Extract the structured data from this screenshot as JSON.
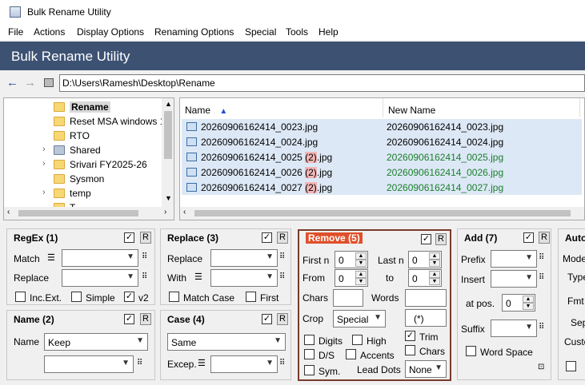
{
  "window": {
    "title": "Bulk Rename Utility"
  },
  "menu": [
    "File",
    "Actions",
    "Display Options",
    "Renaming Options",
    "Special",
    "Tools",
    "Help"
  ],
  "banner": "Bulk Rename Utility",
  "path": "D:\\Users\\Ramesh\\Desktop\\Rename",
  "tree": [
    {
      "label": "Rename",
      "selected": true,
      "expandable": false
    },
    {
      "label": "Reset MSA windows 1",
      "expandable": false
    },
    {
      "label": "RTO",
      "expandable": false
    },
    {
      "label": "Shared",
      "expandable": true
    },
    {
      "label": "Srivari FY2025-26",
      "expandable": true
    },
    {
      "label": "Sysmon",
      "expandable": false
    },
    {
      "label": "temp",
      "expandable": true
    },
    {
      "label": "T...",
      "expandable": false
    }
  ],
  "columns": {
    "name": "Name",
    "new_name": "New Name"
  },
  "files": [
    {
      "name_pre": "20260906162414_0023",
      "name_hl": "",
      "name_post": ".jpg",
      "new_name": "20260906162414_0023.jpg",
      "changed": false
    },
    {
      "name_pre": "20260906162414_0024",
      "name_hl": "",
      "name_post": ".jpg",
      "new_name": "20260906162414_0024.jpg",
      "changed": false
    },
    {
      "name_pre": "20260906162414_0025 ",
      "name_hl": "(2)",
      "name_post": ".jpg",
      "new_name": "20260906162414_0025.jpg",
      "changed": true
    },
    {
      "name_pre": "20260906162414_0026 ",
      "name_hl": "(2)",
      "name_post": ".jpg",
      "new_name": "20260906162414_0026.jpg",
      "changed": true
    },
    {
      "name_pre": "20260906162414_0027 ",
      "name_hl": "(2)",
      "name_post": ".jpg",
      "new_name": "20260906162414_0027.jpg",
      "changed": true
    }
  ],
  "regex": {
    "title": "RegEx (1)",
    "match_label": "Match",
    "replace_label": "Replace",
    "incext": "Inc.Ext.",
    "simple": "Simple",
    "v2": "v2"
  },
  "replace": {
    "title": "Replace (3)",
    "replace_label": "Replace",
    "with_label": "With",
    "match_case": "Match Case",
    "first": "First"
  },
  "name": {
    "title": "Name (2)",
    "label": "Name",
    "value": "Keep"
  },
  "case": {
    "title": "Case (4)",
    "value": "Same",
    "excep_label": "Excep."
  },
  "remove": {
    "title": "Remove (5)",
    "first_n": "First n",
    "first_n_val": "0",
    "last_n": "Last n",
    "last_n_val": "0",
    "from": "From",
    "from_val": "0",
    "to": "to",
    "to_val": "0",
    "chars": "Chars",
    "words": "Words",
    "crop": "Crop",
    "crop_val": "Special",
    "crop_text": "(*)",
    "digits": "Digits",
    "high": "High",
    "trim": "Trim",
    "ds": "D/S",
    "accents": "Accents",
    "chars2": "Chars",
    "sym": "Sym.",
    "lead_dots": "Lead Dots",
    "lead_val": "None"
  },
  "add": {
    "title": "Add (7)",
    "prefix": "Prefix",
    "insert": "Insert",
    "at_pos": "at pos.",
    "pos_val": "0",
    "suffix": "Suffix",
    "word_space": "Word Space"
  },
  "auto": {
    "title": "Auto",
    "mode": "Mode",
    "type": "Type",
    "fmt": "Fmt",
    "sep": "Sep",
    "custom": "Custo"
  },
  "r_label": "R",
  "colors": {
    "banner": "#3d5273",
    "remove_title_bg": "#e0502a",
    "changed": "#1a7f2a",
    "highlight": "#f4b6b6"
  }
}
